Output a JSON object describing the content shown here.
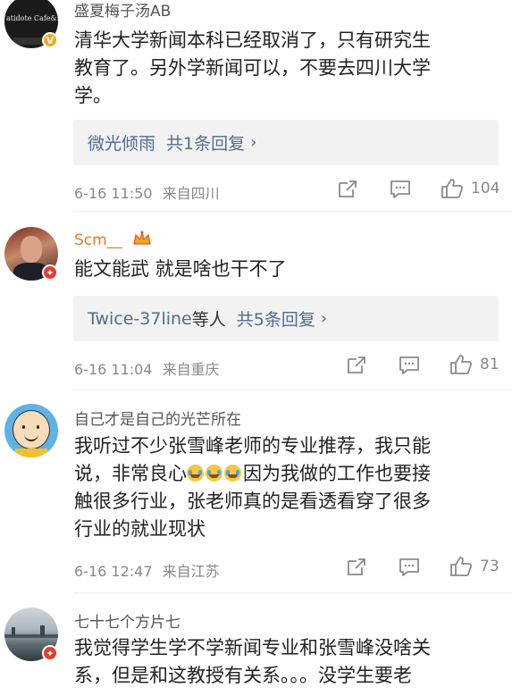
{
  "comments": [
    {
      "username": "盛夏梅子汤AB",
      "text_lines": [
        "清华大学新闻本科已经取消了，只有研究生",
        "教育了。另外学新闻可以，不要去四川大学",
        "学。"
      ],
      "avatar_text": "atidote Cafe&Ba",
      "reply": {
        "name": "微光倾雨",
        "summary": "共1条回复"
      },
      "time": "6-16 11:50",
      "location": "来自四川",
      "likes": "104"
    },
    {
      "username": "Scm__",
      "text": "能文能武 就是啥也干不了",
      "reply": {
        "name": "Twice-37line",
        "name_suffix": "等人",
        "summary": "共5条回复"
      },
      "time": "6-16 11:04",
      "location": "来自重庆",
      "likes": "81"
    },
    {
      "username": "自己才是自己的光芒所在",
      "text_line1": "我听过不少张雪峰老师的专业推荐，我只能",
      "text_line2_before": "说，非常良心",
      "text_line2_after": "因为我做的工作也要接",
      "text_line3": "触很多行业，张老师真的是看透看穿了很多",
      "text_line4": "行业的就业现状",
      "time": "6-16 12:47",
      "location": "来自江苏",
      "likes": "73"
    },
    {
      "username": "七十七个方片七",
      "text_lines": [
        "我觉得学生学不学新闻专业和张雪峰没啥关",
        "系，但是和这教授有关系。。。没学生要老"
      ]
    }
  ],
  "colors": {
    "link": "#4f6d91",
    "username_highlight": "#e87a1e",
    "meta": "#888888",
    "reply_bg": "#f2f2f2"
  },
  "icons": [
    "share-icon",
    "comment-icon",
    "like-icon",
    "crown-icon",
    "verified-badge-icon",
    "crying-laugh-emoji"
  ]
}
